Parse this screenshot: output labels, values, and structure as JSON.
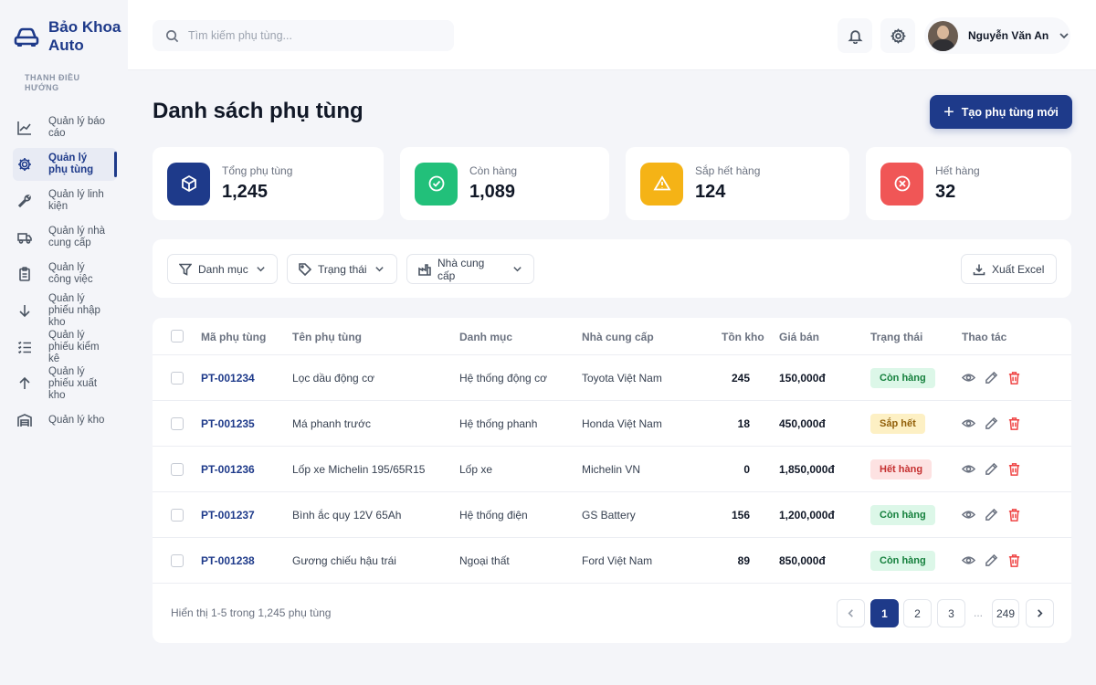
{
  "brand": {
    "name": "Bảo Khoa Auto",
    "icon": "car-icon"
  },
  "sidebar": {
    "heading": "THANH ĐIỀU HƯỚNG",
    "items": [
      {
        "label": "Quản lý báo cáo",
        "icon": "chart-line-icon",
        "active": false
      },
      {
        "label": "Quản lý phụ tùng",
        "icon": "gear-icon",
        "active": true
      },
      {
        "label": "Quản lý linh kiện",
        "icon": "wrench-icon",
        "active": false
      },
      {
        "label": "Quản lý nhà cung cấp",
        "icon": "truck-icon",
        "active": false
      },
      {
        "label": "Quản lý công việc",
        "icon": "clipboard-icon",
        "active": false
      },
      {
        "label": "Quản lý phiếu nhập kho",
        "icon": "arrow-down-icon",
        "active": false
      },
      {
        "label": "Quản lý phiếu kiểm kê",
        "icon": "checklist-icon",
        "active": false
      },
      {
        "label": "Quản lý phiếu xuất kho",
        "icon": "arrow-up-icon",
        "active": false
      },
      {
        "label": "Quản lý kho",
        "icon": "warehouse-icon",
        "active": false
      }
    ]
  },
  "header": {
    "search_placeholder": "Tìm kiếm phụ tùng...",
    "user_name": "Nguyễn Văn An"
  },
  "page": {
    "title": "Danh sách phụ tùng",
    "create_button": "Tạo phụ tùng mới"
  },
  "stats": [
    {
      "label": "Tổng phụ tùng",
      "value": "1,245",
      "color": "#1e3a8a",
      "icon": "box-icon"
    },
    {
      "label": "Còn hàng",
      "value": "1,089",
      "color": "#22c07a",
      "icon": "check-circle-icon"
    },
    {
      "label": "Sắp hết hàng",
      "value": "124",
      "color": "#f5b316",
      "icon": "warning-icon"
    },
    {
      "label": "Hết hàng",
      "value": "32",
      "color": "#f05656",
      "icon": "x-circle-icon"
    }
  ],
  "filters": {
    "category": "Danh mục",
    "status": "Trạng thái",
    "supplier": "Nhà cung cấp",
    "export": "Xuất Excel"
  },
  "table": {
    "columns": [
      "Mã phụ tùng",
      "Tên phụ tùng",
      "Danh mục",
      "Nhà cung cấp",
      "Tồn kho",
      "Giá bán",
      "Trạng thái",
      "Thao tác"
    ],
    "rows": [
      {
        "code": "PT-001234",
        "name": "Lọc dầu động cơ",
        "category": "Hệ thống động cơ",
        "supplier": "Toyota Việt Nam",
        "stock": "245",
        "price": "150,000đ",
        "status": "Còn hàng",
        "status_type": "in"
      },
      {
        "code": "PT-001235",
        "name": "Má phanh trước",
        "category": "Hệ thống phanh",
        "supplier": "Honda Việt Nam",
        "stock": "18",
        "price": "450,000đ",
        "status": "Sắp hết",
        "status_type": "low"
      },
      {
        "code": "PT-001236",
        "name": "Lốp xe Michelin 195/65R15",
        "category": "Lốp xe",
        "supplier": "Michelin VN",
        "stock": "0",
        "price": "1,850,000đ",
        "status": "Hết hàng",
        "status_type": "out"
      },
      {
        "code": "PT-001237",
        "name": "Bình ắc quy 12V 65Ah",
        "category": "Hệ thống điện",
        "supplier": "GS Battery",
        "stock": "156",
        "price": "1,200,000đ",
        "status": "Còn hàng",
        "status_type": "in"
      },
      {
        "code": "PT-001238",
        "name": "Gương chiếu hậu trái",
        "category": "Ngoại thất",
        "supplier": "Ford Việt Nam",
        "stock": "89",
        "price": "850,000đ",
        "status": "Còn hàng",
        "status_type": "in"
      }
    ]
  },
  "pagination": {
    "summary": "Hiển thị 1-5 trong 1,245 phụ tùng",
    "pages": [
      "1",
      "2",
      "3"
    ],
    "ellipsis": "...",
    "last": "249",
    "current": "1"
  },
  "status_colors": {
    "in": {
      "bg": "#dcf7e8",
      "fg": "#15803d"
    },
    "low": {
      "bg": "#fdf0c4",
      "fg": "#92600a"
    },
    "out": {
      "bg": "#fde2e2",
      "fg": "#c53030"
    }
  }
}
